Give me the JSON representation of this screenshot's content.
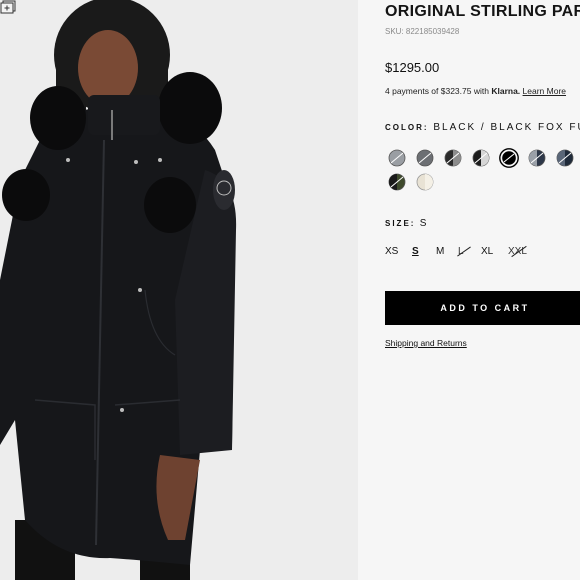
{
  "product": {
    "title": "ORIGINAL STIRLING PARKA",
    "sku": "SKU: 822185039428",
    "price": "$1295.00",
    "klarna_prefix": "4 payments of $323.75 with",
    "klarna_brand": "Klarna.",
    "klarna_link": "Learn More"
  },
  "color": {
    "label": "COLOR:",
    "value": "BLACK / BLACK FOX FUR",
    "swatches": [
      {
        "name": "grey-black-fur",
        "fill": "#9a9ea3",
        "selected": false
      },
      {
        "name": "charcoal-fur",
        "fill": "#6c6f73",
        "selected": false
      },
      {
        "name": "black-grey-fur",
        "fill": "#2a2a2a",
        "selected": false
      },
      {
        "name": "black-frost-fur",
        "fill": "#1c1c1c",
        "selected": false
      },
      {
        "name": "black-black-fox-fur",
        "fill": "#000000",
        "selected": true
      },
      {
        "name": "navy-fur",
        "fill": "#2d3748",
        "selected": false
      },
      {
        "name": "navy-black-fur",
        "fill": "#1f2a3a",
        "selected": false
      },
      {
        "name": "army-green-fur",
        "fill": "#3e4a2c",
        "selected": false
      },
      {
        "name": "cream-fur",
        "fill": "#e8e2d4",
        "selected": false
      }
    ]
  },
  "size": {
    "label": "SIZE:",
    "value": "S",
    "options": [
      {
        "label": "XS",
        "state": "available"
      },
      {
        "label": "S",
        "state": "selected"
      },
      {
        "label": "M",
        "state": "available"
      },
      {
        "label": "L",
        "state": "sold-out"
      },
      {
        "label": "XL",
        "state": "available"
      },
      {
        "label": "XXL",
        "state": "sold-out"
      }
    ]
  },
  "actions": {
    "add_to_cart": "ADD TO CART",
    "shipping_link": "Shipping and Returns"
  }
}
